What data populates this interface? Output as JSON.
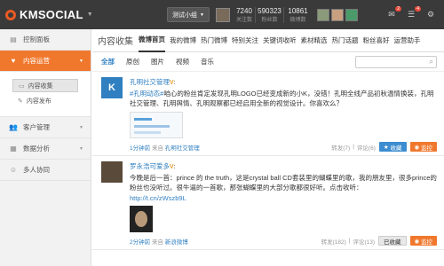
{
  "header": {
    "logo": "KMSOCIAL",
    "group_select": "测试小组",
    "stats": [
      {
        "num": "7240",
        "lbl": "关注数"
      },
      {
        "num": "590323",
        "lbl": "粉丝数"
      },
      {
        "num": "10861",
        "lbl": "微博数"
      }
    ],
    "badges": {
      "mail": "2",
      "notice": "4"
    }
  },
  "sidebar": {
    "items": [
      {
        "label": "控制面板",
        "icon": "dashboard-icon"
      },
      {
        "label": "内容运营",
        "icon": "heart-icon"
      },
      {
        "label": "客户管理",
        "icon": "users-icon"
      },
      {
        "label": "数据分析",
        "icon": "chart-icon"
      },
      {
        "label": "多人协同",
        "icon": "team-icon"
      }
    ],
    "subitems": [
      {
        "label": "内容收集",
        "icon": "collect-icon"
      },
      {
        "label": "内容发布",
        "icon": "publish-icon"
      }
    ]
  },
  "main": {
    "page_title": "内容收集",
    "tabs": [
      "微博首页",
      "我的微博",
      "热门微博",
      "特别关注",
      "关键词收听",
      "素材精选",
      "热门话题",
      "粉丝喜好",
      "运营助手"
    ],
    "filters": [
      "全部",
      "原创",
      "图片",
      "视频",
      "音乐"
    ],
    "posts": [
      {
        "name": "孔明社交管理",
        "tag": "#孔明动态#",
        "text": "咱心的粉丝肯定发现孔明LOGO已经变成新的小K，没错！孔明全线产品初秋温情换装，孔明社交管理、孔明舆情、孔明观察都已经启用全新的视觉设计。你喜欢么？",
        "time": "1分钟前",
        "from": "来自",
        "source": "孔明社交管理",
        "repost": "转发(7)",
        "comment": "评论(6)",
        "btn_fav": "收藏",
        "btn_monitor": "监控"
      },
      {
        "name": "罗永浩可爱多",
        "text": "今晚是后一首：prince 的 the truth，这是crystal ball CD套装里的蝴蝶里的歌，我的朋友里，很多prince的粉丝也没听过。很牛逼的一首歌，那张蝴蝶里的大部分歌都很好听。点击收听：",
        "link": "http://t.cn/zWszb9L",
        "time": "2分钟前",
        "from": "来自",
        "source": "新浪微博",
        "repost": "转发(182)",
        "comment": "评论(13)",
        "btn_fav": "已收藏",
        "btn_monitor": "监控"
      }
    ]
  },
  "colors": {
    "accent": "#f0782d",
    "link": "#2f7fc1",
    "topbar": "#3a3a3a"
  }
}
